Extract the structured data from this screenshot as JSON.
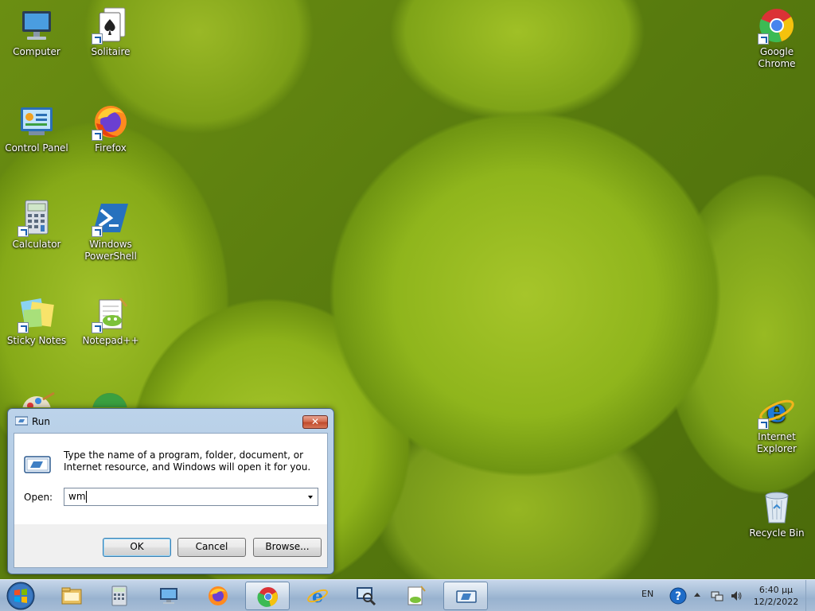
{
  "desktop": {
    "icons": {
      "computer": "Computer",
      "solitaire": "Solitaire",
      "google_chrome": "Google Chrome",
      "control_panel": "Control Panel",
      "firefox": "Firefox",
      "calculator": "Calculator",
      "powershell": "Windows PowerShell",
      "sticky_notes": "Sticky Notes",
      "notepadpp": "Notepad++",
      "internet_explorer": "Internet Explorer",
      "recycle_bin": "Recycle Bin"
    }
  },
  "run_dialog": {
    "title": "Run",
    "close_label": "✕",
    "description": "Type the name of a program, folder, document, or Internet resource, and Windows will open it for you.",
    "open_label": "Open:",
    "open_value": "wm",
    "ok_label": "OK",
    "cancel_label": "Cancel",
    "browse_label": "Browse..."
  },
  "taskbar": {
    "items": [
      "start",
      "file-explorer",
      "calculator",
      "remote-desktop",
      "firefox",
      "chrome",
      "internet-explorer",
      "magnifier",
      "notepadpp",
      "run"
    ],
    "active_item": "chrome",
    "tray": {
      "language": "EN",
      "time": "6:40 µµ",
      "date": "12/2/2022"
    }
  }
}
